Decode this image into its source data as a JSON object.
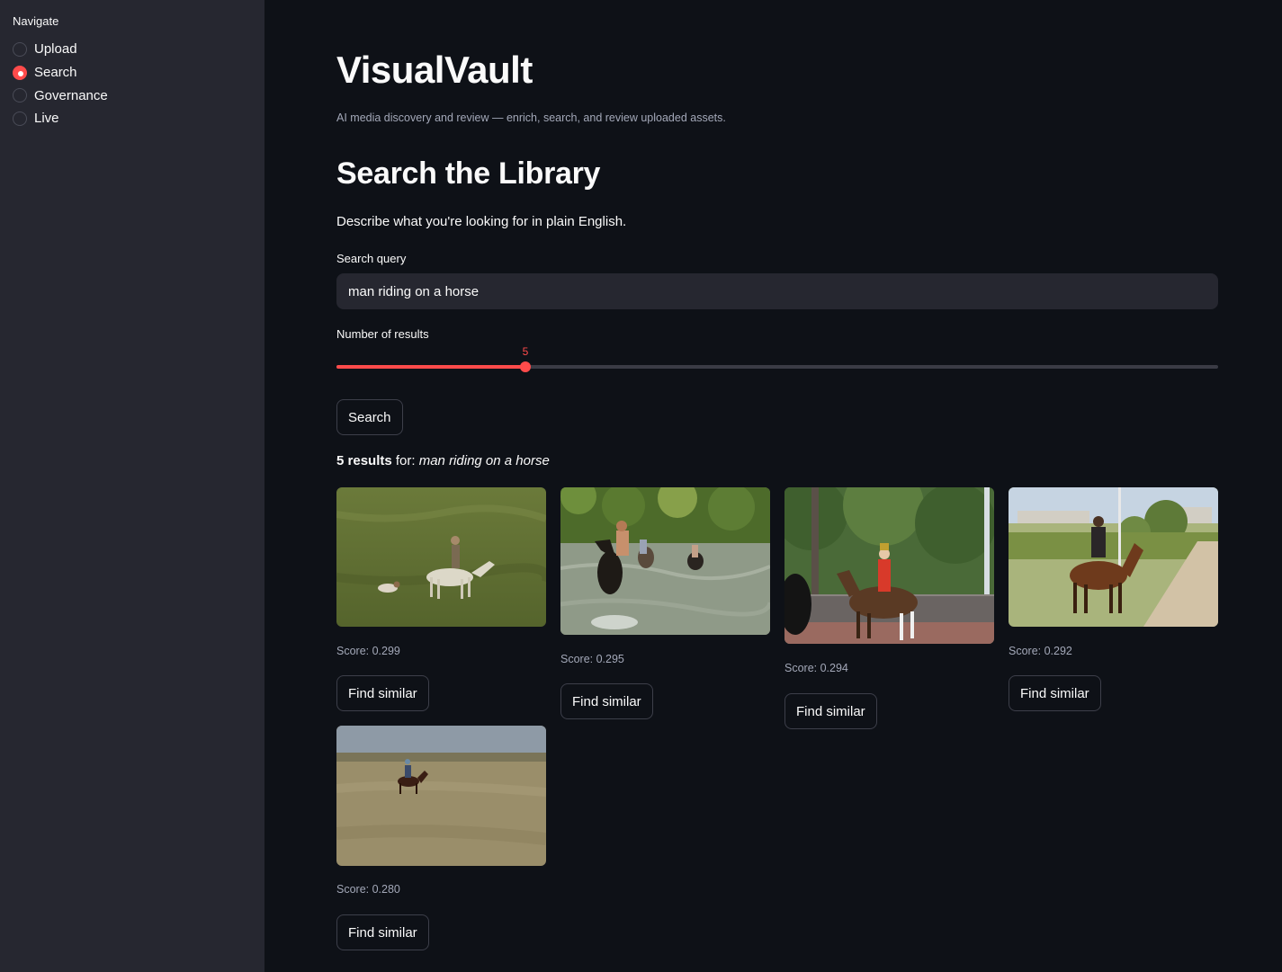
{
  "sidebar": {
    "label": "Navigate",
    "items": [
      {
        "label": "Upload",
        "selected": false
      },
      {
        "label": "Search",
        "selected": true
      },
      {
        "label": "Governance",
        "selected": false
      },
      {
        "label": "Live",
        "selected": false
      }
    ]
  },
  "header": {
    "title": "VisualVault",
    "caption": "AI media discovery and review — enrich, search, and review uploaded assets."
  },
  "search": {
    "section_title": "Search the Library",
    "description": "Describe what you're looking for in plain English.",
    "query_label": "Search query",
    "query_value": "man riding on a horse",
    "count_label": "Number of results",
    "count_value": "5",
    "count_fraction": 0.214,
    "button_label": "Search"
  },
  "results": {
    "count_text": "5 results",
    "for_text": " for: ",
    "query_text": "man riding on a horse",
    "items": [
      {
        "score": "Score: 0.299",
        "button": "Find similar",
        "image": "horse-field-image"
      },
      {
        "score": "Score: 0.295",
        "button": "Find similar",
        "image": "horse-river-image"
      },
      {
        "score": "Score: 0.294",
        "button": "Find similar",
        "image": "horse-guard-image"
      },
      {
        "score": "Score: 0.292",
        "button": "Find similar",
        "image": "horse-path-image"
      },
      {
        "score": "Score: 0.280",
        "button": "Find similar",
        "image": "horse-plain-image"
      }
    ]
  },
  "colors": {
    "accent": "#ff4b4b",
    "background": "#0e1117",
    "sidebar": "#262730"
  }
}
